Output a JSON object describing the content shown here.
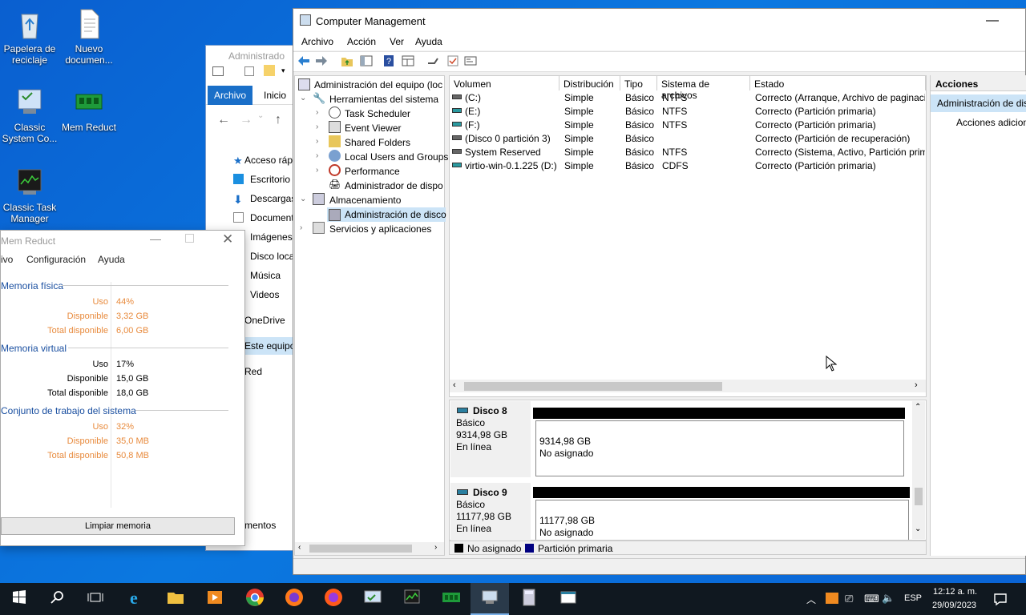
{
  "desktop": {
    "icons": [
      {
        "label": "Papelera de reciclaje"
      },
      {
        "label": "Nuevo documen..."
      },
      {
        "label": "Classic System Co..."
      },
      {
        "label": "Mem Reduct"
      },
      {
        "label": "Classic Task Manager"
      }
    ]
  },
  "explorer": {
    "title": "Administrado",
    "tab_active": "Archivo",
    "tab_inicio": "Inicio",
    "nav": [
      "Acceso rápi",
      "Escritorio",
      "Descargas",
      "Document",
      "Imágenes",
      "Disco local",
      "Música",
      "Videos",
      "OneDrive",
      "Este equipo",
      "Red"
    ],
    "footer": "mentos"
  },
  "memreduct": {
    "title": "Mem Reduct",
    "menu": [
      "ivo",
      "Configuración",
      "Ayuda"
    ],
    "sections": [
      {
        "name": "Memoria física",
        "rows": [
          [
            "Uso",
            "44%"
          ],
          [
            "Disponible",
            "3,32 GB"
          ],
          [
            "Total disponible",
            "6,00 GB"
          ]
        ]
      },
      {
        "name": "Memoria virtual",
        "rows": [
          [
            "Uso",
            "17%"
          ],
          [
            "Disponible",
            "15,0 GB"
          ],
          [
            "Total disponible",
            "18,0 GB"
          ]
        ]
      },
      {
        "name": "Conjunto de trabajo del sistema",
        "rows": [
          [
            "Uso",
            "32%"
          ],
          [
            "Disponible",
            "35,0 MB"
          ],
          [
            "Total disponible",
            "50,8 MB"
          ]
        ]
      }
    ],
    "clean_button": "Limpiar memoria"
  },
  "cm": {
    "title": "Computer Management",
    "menu": [
      "Archivo",
      "Acción",
      "Ver",
      "Ayuda"
    ],
    "tree": {
      "root": "Administración del equipo (loc",
      "tools": "Herramientas del sistema",
      "children": [
        "Task Scheduler",
        "Event Viewer",
        "Shared Folders",
        "Local Users and Groups",
        "Performance",
        "Administrador de dispo"
      ],
      "storage": "Almacenamiento",
      "disk_mgmt": "Administración de disco",
      "services": "Servicios y aplicaciones"
    },
    "columns": [
      "Volumen",
      "Distribución",
      "Tipo",
      "Sistema de archivos",
      "Estado"
    ],
    "volumes": [
      [
        "(C:)",
        "Simple",
        "Básico",
        "NTFS",
        "Correcto (Arranque, Archivo de paginaci"
      ],
      [
        "(E:)",
        "Simple",
        "Básico",
        "NTFS",
        "Correcto (Partición primaria)"
      ],
      [
        "(F:)",
        "Simple",
        "Básico",
        "NTFS",
        "Correcto (Partición primaria)"
      ],
      [
        "(Disco 0 partición 3)",
        "Simple",
        "Básico",
        "",
        "Correcto (Partición de recuperación)"
      ],
      [
        "System Reserved",
        "Simple",
        "Básico",
        "NTFS",
        "Correcto (Sistema, Activo, Partición prim"
      ],
      [
        "virtio-win-0.1.225 (D:)",
        "Simple",
        "Básico",
        "CDFS",
        "Correcto (Partición primaria)"
      ]
    ],
    "disks": [
      {
        "name": "Disco 8",
        "type": "Básico",
        "size": "9314,98 GB",
        "status": "En línea",
        "part_size": "9314,98 GB",
        "part_state": "No asignado"
      },
      {
        "name": "Disco 9",
        "type": "Básico",
        "size": "11177,98 GB",
        "status": "En línea",
        "part_size": "11177,98 GB",
        "part_state": "No asignado"
      }
    ],
    "legend": [
      "No asignado",
      "Partición primaria"
    ],
    "actions": {
      "header": "Acciones",
      "item1": "Administración de dis",
      "item2": "Acciones adicion"
    }
  },
  "taskbar": {
    "lang": "ESP",
    "time": "12:12 a. m.",
    "date": "29/09/2023"
  },
  "colors": {
    "accent": "#1a6fc8",
    "orange": "#e88a3c",
    "primary_partition": "#000080"
  }
}
